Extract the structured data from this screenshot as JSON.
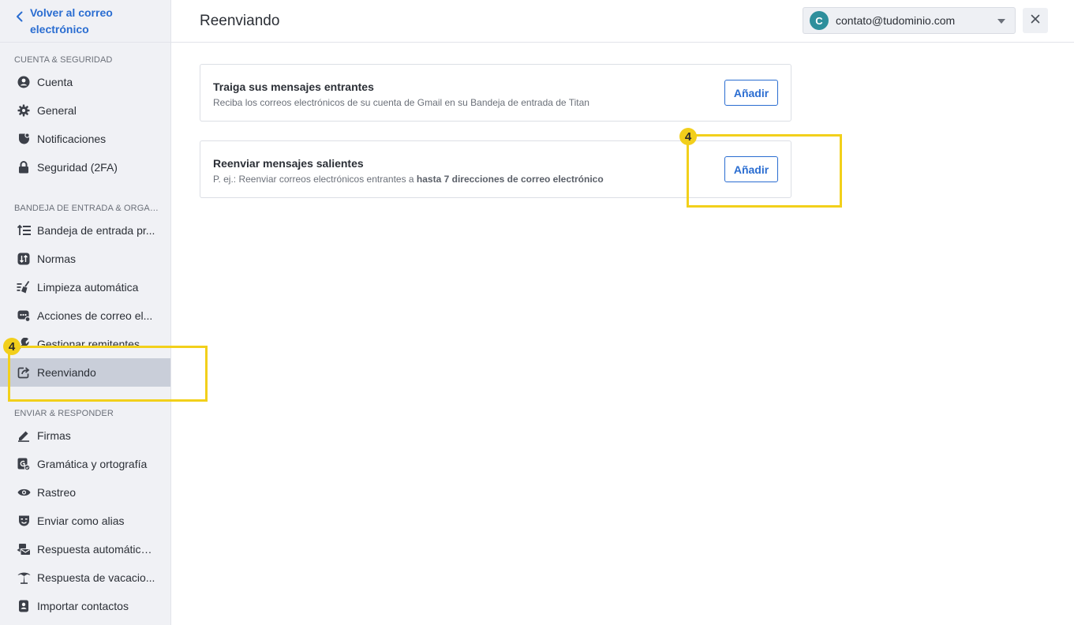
{
  "sidebar": {
    "back_label": "Volver al correo electrónico",
    "sections": [
      {
        "label": "CUENTA & SEGURIDAD"
      },
      {
        "label": "BANDEJA DE ENTRADA & ORGANIZACIÓN"
      },
      {
        "label": "ENVIAR & RESPONDER"
      }
    ],
    "section_display": [
      "CUENTA & SEGURIDAD",
      "BANDEJA DE ENTRADA & ORGAN...",
      "ENVIAR & RESPONDER"
    ],
    "items": [
      {
        "label": "Cuenta",
        "icon": "account-icon"
      },
      {
        "label": "General",
        "icon": "gear-icon"
      },
      {
        "label": "Notificaciones",
        "icon": "notification-icon"
      },
      {
        "label": "Seguridad (2FA)",
        "icon": "lock-icon"
      },
      {
        "label": "Bandeja de entrada pr...",
        "icon": "priority-inbox-icon"
      },
      {
        "label": "Normas",
        "icon": "rules-icon"
      },
      {
        "label": "Limpieza automática",
        "icon": "broom-icon"
      },
      {
        "label": "Acciones de correo el...",
        "icon": "email-actions-icon"
      },
      {
        "label": "Gestionar remitentes",
        "icon": "wrench-icon"
      },
      {
        "label": "Reenviando",
        "icon": "forward-icon",
        "active": true
      },
      {
        "label": "Firmas",
        "icon": "pen-icon"
      },
      {
        "label": "Gramática y ortografía",
        "icon": "grammar-icon"
      },
      {
        "label": "Rastreo",
        "icon": "eye-icon"
      },
      {
        "label": "Enviar como alias",
        "icon": "mask-icon"
      },
      {
        "label": "Respuesta automática...",
        "icon": "auto-reply-icon"
      },
      {
        "label": "Respuesta de vacacio...",
        "icon": "palm-tree-icon"
      },
      {
        "label": "Importar contactos",
        "icon": "contacts-icon"
      }
    ]
  },
  "header": {
    "title": "Reenviando",
    "account": {
      "initial": "C",
      "email": "contato@tudominio.com"
    }
  },
  "cards": [
    {
      "title": "Traiga sus mensajes entrantes",
      "description": "Reciba los correos electrónicos de su cuenta de Gmail en su Bandeja de entrada de Titan",
      "button": "Añadir"
    },
    {
      "title": "Reenviar mensajes salientes",
      "description_prefix": "P. ej.: Reenviar correos electrónicos entrantes a ",
      "description_bold": "hasta 7 direcciones de correo electrónico",
      "button": "Añadir"
    }
  ],
  "annotations": [
    {
      "badge": "4",
      "target": "Reenviando sidebar item"
    },
    {
      "badge": "4",
      "target": "Reenviar mensajes salientes Añadir button"
    }
  ],
  "colors": {
    "accent": "#2a6dd1",
    "sidebar_bg": "#f0f1f5",
    "active_item_bg": "#c9ced9",
    "highlight": "#f2d01b",
    "avatar": "#2e8f9c"
  }
}
